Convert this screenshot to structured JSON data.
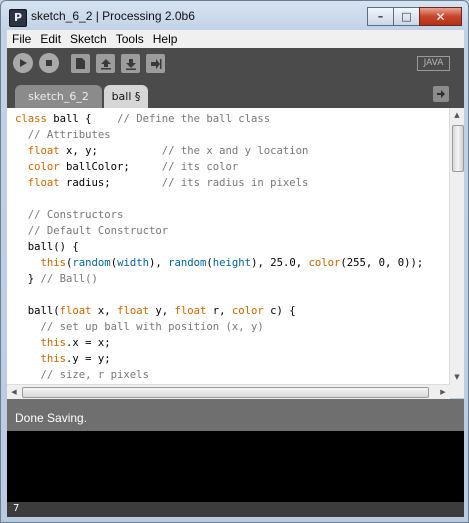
{
  "window": {
    "title": "sketch_6_2 | Processing 2.0b6",
    "app_icon_glyph": "P"
  },
  "menu": [
    "File",
    "Edit",
    "Sketch",
    "Tools",
    "Help"
  ],
  "toolbar": {
    "buttons": [
      "run",
      "stop",
      "new",
      "open",
      "save",
      "export"
    ],
    "mode_label": "JAVA"
  },
  "tabs": [
    {
      "label": "sketch_6_2",
      "active": false
    },
    {
      "label": "ball §",
      "active": true
    }
  ],
  "editor": {
    "lines": [
      "class ball {    // Define the ball class",
      "  // Attributes",
      "  float x, y;          // the x and y location",
      "  color ballColor;     // its color",
      "  float radius;        // its radius in pixels",
      "",
      "  // Constructors",
      "  // Default Constructor",
      "  ball() {",
      "    this(random(width), random(height), 25.0, color(255, 0, 0));",
      "  } // Ball()",
      "",
      "  ball(float x, float y, float r, color c) {",
      "    // set up ball with position (x, y)",
      "    this.x = x;",
      "    this.y = y;",
      "    // size, r pixels"
    ]
  },
  "status": {
    "message": "Done Saving."
  },
  "console": {
    "text": ""
  },
  "line_indicator": "7",
  "colors": {
    "keyword": "#cc6600",
    "builtin": "#006699",
    "comment": "#777777",
    "toolbar_bg": "#4b4b4b",
    "status_bg": "#6f6f6f"
  }
}
